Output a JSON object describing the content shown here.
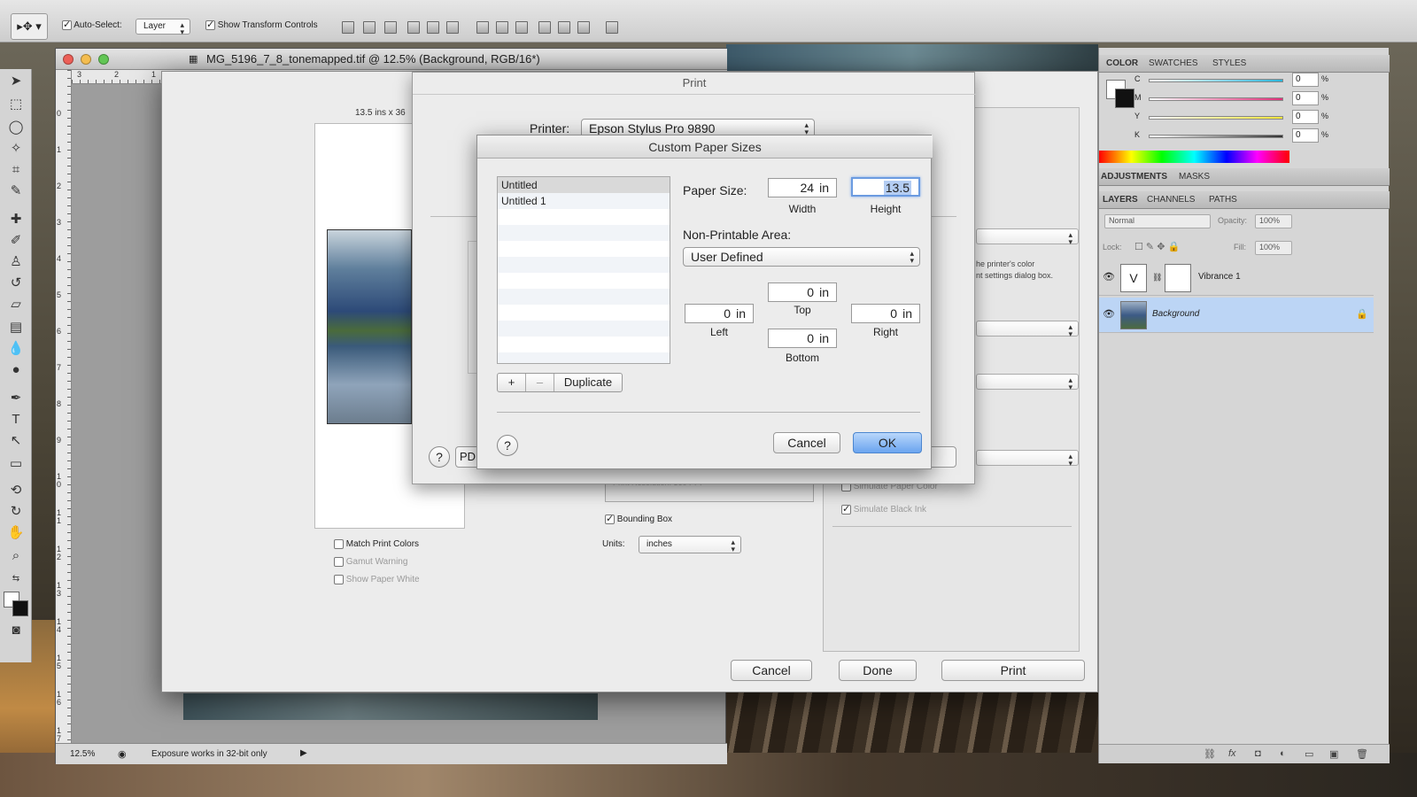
{
  "options_bar": {
    "auto_select_label": "Auto-Select:",
    "auto_select_value": "Layer",
    "transform_label": "Show Transform Controls"
  },
  "document": {
    "title": "MG_5196_7_8_tonemapped.tif @ 12.5% (Background, RGB/16*)",
    "zoom": "12.5%",
    "status": "Exposure works in 32-bit only",
    "ruler_h": [
      "3",
      "2",
      "1"
    ],
    "ruler_v": [
      "0",
      "1",
      "2",
      "3",
      "4",
      "5",
      "6",
      "7",
      "8",
      "9",
      "1 0",
      "1 1",
      "1 2",
      "1 3",
      "1 4",
      "1 5",
      "1 6",
      "1 7"
    ]
  },
  "print_dialog": {
    "sheet_title": "Print",
    "printer_label": "Printer:",
    "printer_value": "Epson Stylus Pro 9890",
    "preview_size": "13.5 ins x 36",
    "pdf_label": "PDF",
    "printer_note": "he printer's color\nnt settings dialog box.",
    "sim_paper": "Simulate Paper Color",
    "sim_black": "Simulate Black Ink",
    "match_colors": "Match Print Colors",
    "gamut": "Gamut Warning",
    "paper_white": "Show Paper White",
    "bounding_box": "Bounding Box",
    "print_resolution": "Print Resolution: 360 PPI",
    "units_label": "Units:",
    "units_value": "inches",
    "cancel": "Cancel",
    "done": "Done",
    "print": "Print",
    "help": "?"
  },
  "custom_paper": {
    "title": "Custom Paper Sizes",
    "list": [
      "Untitled",
      "Untitled 1"
    ],
    "add": "+",
    "remove": "–",
    "duplicate": "Duplicate",
    "paper_size_label": "Paper Size:",
    "width": "24",
    "height": "13.5",
    "unit": "in",
    "width_caption": "Width",
    "height_caption": "Height",
    "nonprint_label": "Non-Printable Area:",
    "nonprint_value": "User Defined",
    "top": "0",
    "left": "0",
    "right": "0",
    "bottom": "0",
    "top_caption": "Top",
    "left_caption": "Left",
    "right_caption": "Right",
    "bottom_caption": "Bottom",
    "help": "?",
    "cancel": "Cancel",
    "ok": "OK"
  },
  "panels": {
    "color_tabs": [
      "COLOR",
      "SWATCHES",
      "STYLES"
    ],
    "cmyk": [
      {
        "letter": "C",
        "value": "0",
        "color": "#2bb4d8"
      },
      {
        "letter": "M",
        "value": "0",
        "color": "#e0307a"
      },
      {
        "letter": "Y",
        "value": "0",
        "color": "#f2e53a"
      },
      {
        "letter": "K",
        "value": "0",
        "color": "#333333"
      }
    ],
    "pct": "%",
    "adj_tabs": [
      "ADJUSTMENTS",
      "MASKS"
    ],
    "layer_tabs": [
      "LAYERS",
      "CHANNELS",
      "PATHS"
    ],
    "blend_mode": "Normal",
    "opacity_label": "Opacity:",
    "opacity_value": "100%",
    "lock_label": "Lock:",
    "fill_label": "Fill:",
    "fill_value": "100%",
    "layers": [
      "Vibrance 1",
      "Background"
    ]
  }
}
